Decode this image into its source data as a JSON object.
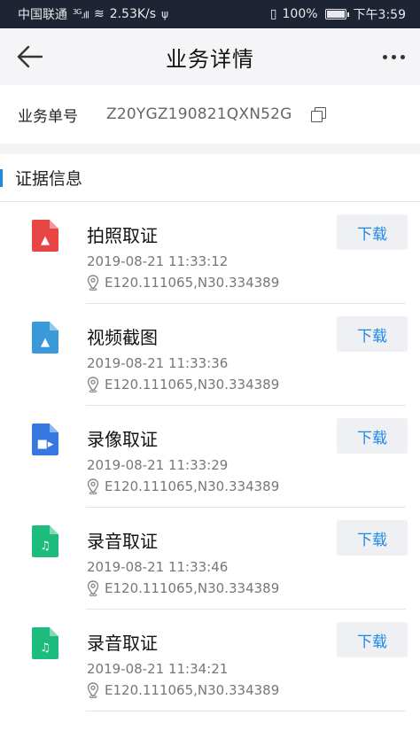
{
  "status": {
    "carrier": "中国联通",
    "network": "3G",
    "speed": "2.53K/s",
    "battery": "100%",
    "battery_level": 1.0,
    "time": "下午3:59"
  },
  "header": {
    "title": "业务详情"
  },
  "business": {
    "label": "业务单号",
    "number": "Z20YGZ190821QXN52G"
  },
  "section": {
    "title": "证据信息"
  },
  "download_label": "下载",
  "evidence": [
    {
      "title": "拍照取证",
      "time": "2019-08-21 11:33:12",
      "location": "E120.111065,N30.334389",
      "icon": "image-file-icon",
      "color": "#e84545"
    },
    {
      "title": "视频截图",
      "time": "2019-08-21 11:33:36",
      "location": "E120.111065,N30.334389",
      "icon": "image-file-icon",
      "color": "#3a9ad9"
    },
    {
      "title": "录像取证",
      "time": "2019-08-21 11:33:29",
      "location": "E120.111065,N30.334389",
      "icon": "video-file-icon",
      "color": "#3677e0"
    },
    {
      "title": "录音取证",
      "time": "2019-08-21 11:33:46",
      "location": "E120.111065,N30.334389",
      "icon": "audio-file-icon",
      "color": "#1ebc7c"
    },
    {
      "title": "录音取证",
      "time": "2019-08-21 11:34:21",
      "location": "E120.111065,N30.334389",
      "icon": "audio-file-icon",
      "color": "#1ebc7c"
    }
  ]
}
